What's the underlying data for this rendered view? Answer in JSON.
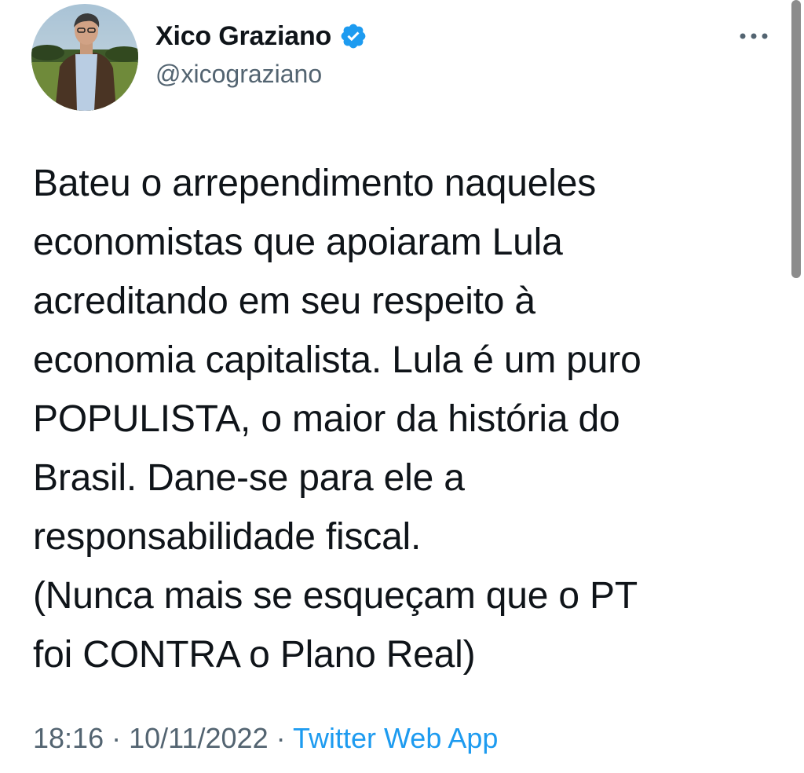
{
  "tweet": {
    "display_name": "Xico Graziano",
    "handle": "@xicograziano",
    "verified": true,
    "verified_icon": "verified-badge-icon",
    "more_icon": "more-options-icon",
    "text": "Bateu o arrependimento naqueles\neconomistas que apoiaram Lula\nacreditando em seu respeito à\neconomia capitalista. Lula é um puro\nPOPULISTA, o maior da história do\nBrasil. Dane-se para ele a\nresponsabilidade fiscal.\n(Nunca mais se esqueçam que o PT\nfoi CONTRA o Plano Real)",
    "time": "18:16",
    "separator": " · ",
    "date": "10/11/2022",
    "source": "Twitter Web App"
  },
  "colors": {
    "text": "#0f1419",
    "secondary": "#536471",
    "accent": "#1d9bf0",
    "scrollbar": "#8c8c8c"
  }
}
